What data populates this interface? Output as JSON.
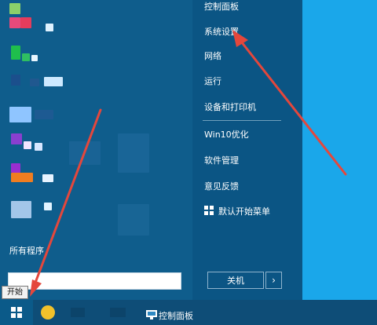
{
  "start_menu": {
    "right_items": [
      {
        "label": "控制面板"
      },
      {
        "label": "系统设置"
      },
      {
        "label": "网络"
      },
      {
        "label": "运行"
      },
      {
        "label": "设备和打印机"
      },
      {
        "label": "Win10优化"
      },
      {
        "label": "软件管理"
      },
      {
        "label": "意见反馈"
      },
      {
        "label": "默认开始菜单"
      }
    ],
    "all_programs": "所有程序",
    "shutdown": "关机",
    "shutdown_arrow": "›"
  },
  "tooltip": "开始",
  "taskbar": {
    "pinned_label": "控制面板"
  },
  "colors": {
    "desktop": "#1aa7ea",
    "menu_left": "#0f5d8c",
    "menu_right": "#0b5584",
    "taskbar": "#0e4d77",
    "arrow": "#e4473c"
  }
}
